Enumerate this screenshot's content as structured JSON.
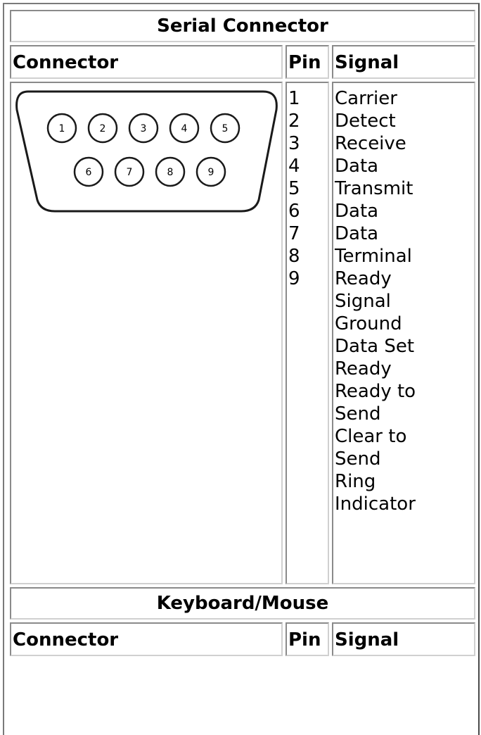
{
  "serial": {
    "title": "Serial Connector",
    "headers": {
      "connector": "Connector",
      "pin": "Pin",
      "signal": "Signal"
    },
    "pins": [
      "1",
      "2",
      "3",
      "4",
      "5",
      "6",
      "7",
      "8",
      "9"
    ],
    "signal_lines": [
      "Carrier",
      "Detect",
      "Receive",
      "Data",
      "Transmit",
      "Data",
      "Data",
      "Terminal",
      "Ready",
      "Signal",
      "Ground",
      "Data Set",
      "Ready",
      "Ready to",
      "Send",
      "Clear to",
      "Send",
      "Ring",
      "Indicator"
    ],
    "diagram_pins": [
      "1",
      "2",
      "3",
      "4",
      "5",
      "6",
      "7",
      "8",
      "9"
    ]
  },
  "keyboard_mouse": {
    "title": "Keyboard/Mouse",
    "headers": {
      "connector": "Connector",
      "pin": "Pin",
      "signal": "Signal"
    }
  }
}
